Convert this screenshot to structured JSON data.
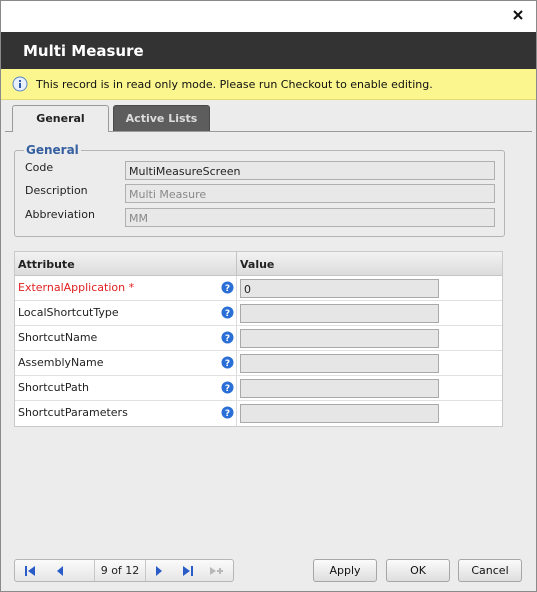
{
  "window": {
    "title": "Multi Measure"
  },
  "notice": {
    "text": "This record is in read only mode. Please run Checkout to enable editing."
  },
  "tabs": [
    {
      "label": "General"
    },
    {
      "label": "Active Lists"
    }
  ],
  "general": {
    "legend": "General",
    "fields": [
      {
        "label": "Code",
        "value": "MultiMeasureScreen"
      },
      {
        "label": "Description",
        "value": "Multi Measure"
      },
      {
        "label": "Abbreviation",
        "value": "MM"
      }
    ]
  },
  "attributes": {
    "header_attribute": "Attribute",
    "header_value": "Value",
    "rows": [
      {
        "name": "ExternalApplication *",
        "required": true,
        "value": "0"
      },
      {
        "name": "LocalShortcutType",
        "value": ""
      },
      {
        "name": "ShortcutName",
        "value": ""
      },
      {
        "name": "AssemblyName",
        "value": ""
      },
      {
        "name": "ShortcutPath",
        "value": ""
      },
      {
        "name": "ShortcutParameters",
        "value": ""
      }
    ]
  },
  "pager": {
    "count": "9 of 12"
  },
  "buttons": {
    "apply": "Apply",
    "ok": "OK",
    "cancel": "Cancel"
  },
  "colors": {
    "titlebar": "#333333",
    "notice_bg": "#fbf68e",
    "legend": "#355fa0",
    "required": "#e02020",
    "help_icon": "#2a6fd6"
  },
  "icons": [
    "close-icon",
    "info-icon",
    "help-icon",
    "first-page-icon",
    "prev-page-icon",
    "next-page-icon",
    "last-page-icon",
    "new-record-icon"
  ]
}
